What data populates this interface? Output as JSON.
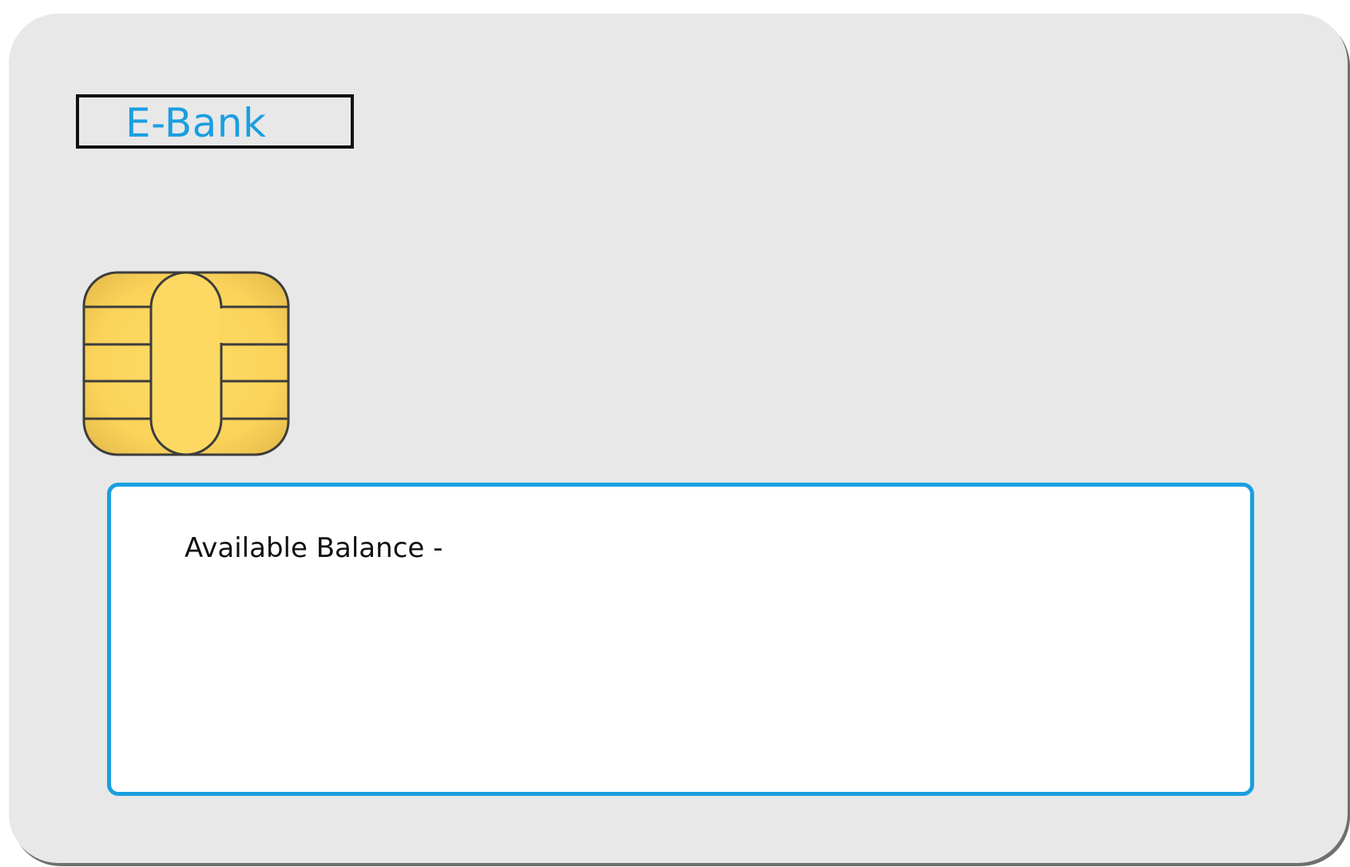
{
  "card": {
    "brand_name": "E-Bank",
    "balance_label": "Available Balance -",
    "chip_icon": "smart-card-chip-icon"
  },
  "colors": {
    "card_background": "#e8e8e8",
    "brand_text": "#1a9fe0",
    "panel_border": "#1a9fe0",
    "chip_gold": "#fbd65c"
  }
}
